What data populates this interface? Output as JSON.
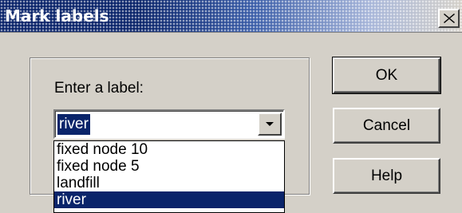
{
  "dialog": {
    "title": "Mark labels",
    "prompt": "Enter a label:",
    "combo_value": "river",
    "options": [
      "fixed node 10",
      "fixed node 5",
      "landfill",
      "river"
    ],
    "selected_index": 3,
    "buttons": {
      "ok": "OK",
      "cancel": "Cancel",
      "help": "Help"
    }
  },
  "colors": {
    "selection": "#0a246a",
    "face": "#d4d0c8"
  },
  "icons": {
    "close": "close-icon",
    "dropdown": "chevron-down-icon"
  }
}
